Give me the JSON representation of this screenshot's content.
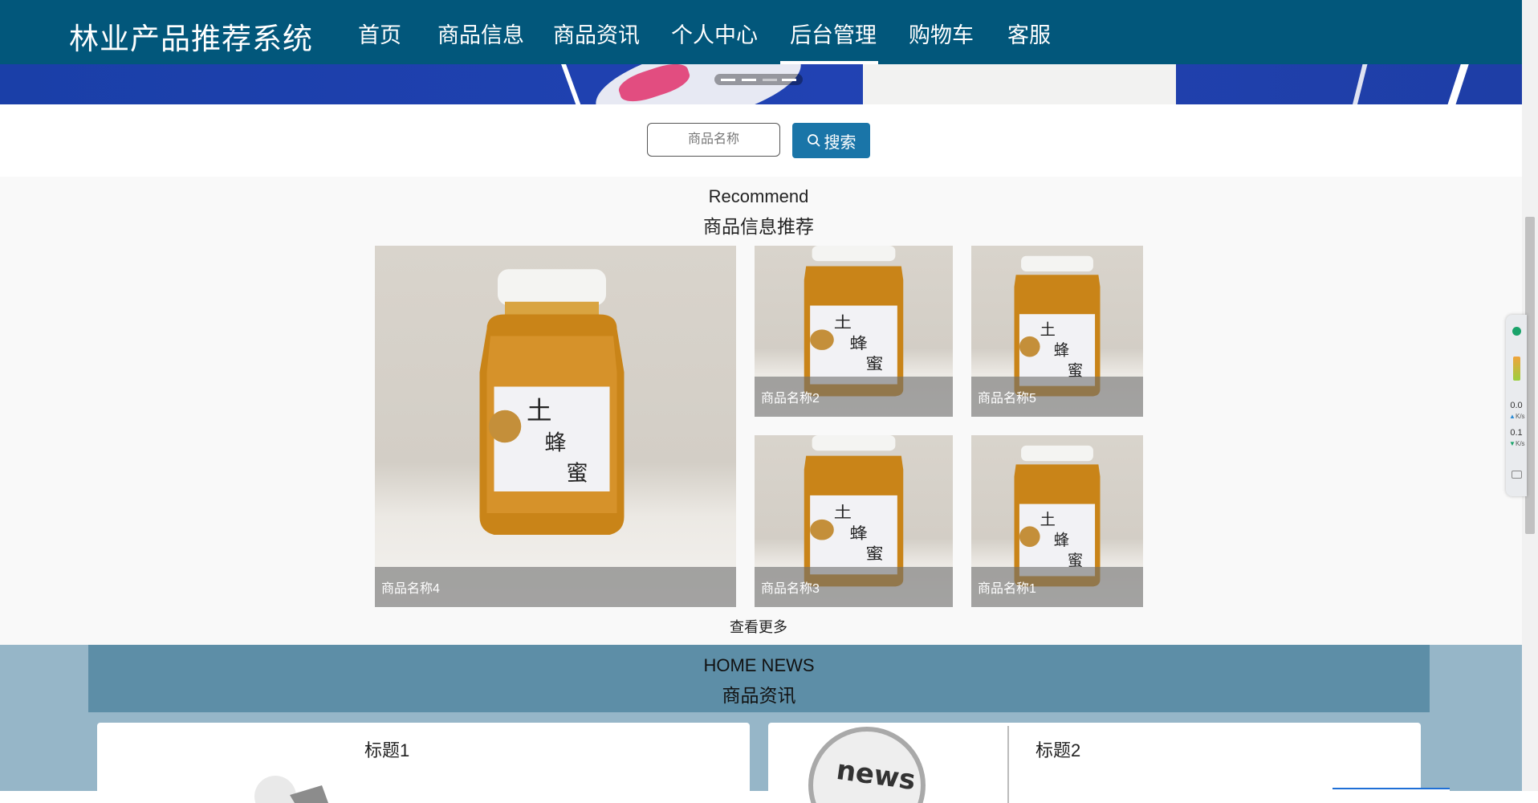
{
  "header": {
    "brand": "林业产品推荐系统",
    "nav": [
      {
        "label": "首页"
      },
      {
        "label": "商品信息"
      },
      {
        "label": "商品资讯"
      },
      {
        "label": "个人中心"
      },
      {
        "label": "后台管理"
      },
      {
        "label": "购物车"
      },
      {
        "label": "客服"
      }
    ],
    "active_item": "后台管理"
  },
  "search": {
    "placeholder": "商品名称",
    "button_label": "搜索",
    "button_icon": "search-icon"
  },
  "recommend": {
    "title_en": "Recommend",
    "title_cn": "商品信息推荐",
    "products": [
      {
        "name": "商品名称4"
      },
      {
        "name": "商品名称2"
      },
      {
        "name": "商品名称5"
      },
      {
        "name": "商品名称3"
      },
      {
        "name": "商品名称1"
      }
    ],
    "jar_label": [
      "土",
      "蜂",
      "蜜"
    ],
    "more_label": "查看更多"
  },
  "news": {
    "title_en": "HOME NEWS",
    "title_cn": "商品资讯",
    "items": [
      {
        "title": "标题1"
      },
      {
        "title": "标题2"
      }
    ],
    "news_image_text": "news"
  },
  "net_widget": {
    "upload_value": "0.0",
    "upload_unit": "K/s",
    "download_value": "0.1",
    "download_unit": "K/s"
  },
  "colors": {
    "nav_bg": "#02577b",
    "search_button": "#1a75a8",
    "news_bg": "#96b6c8",
    "news_header": "#5d8ea7"
  }
}
